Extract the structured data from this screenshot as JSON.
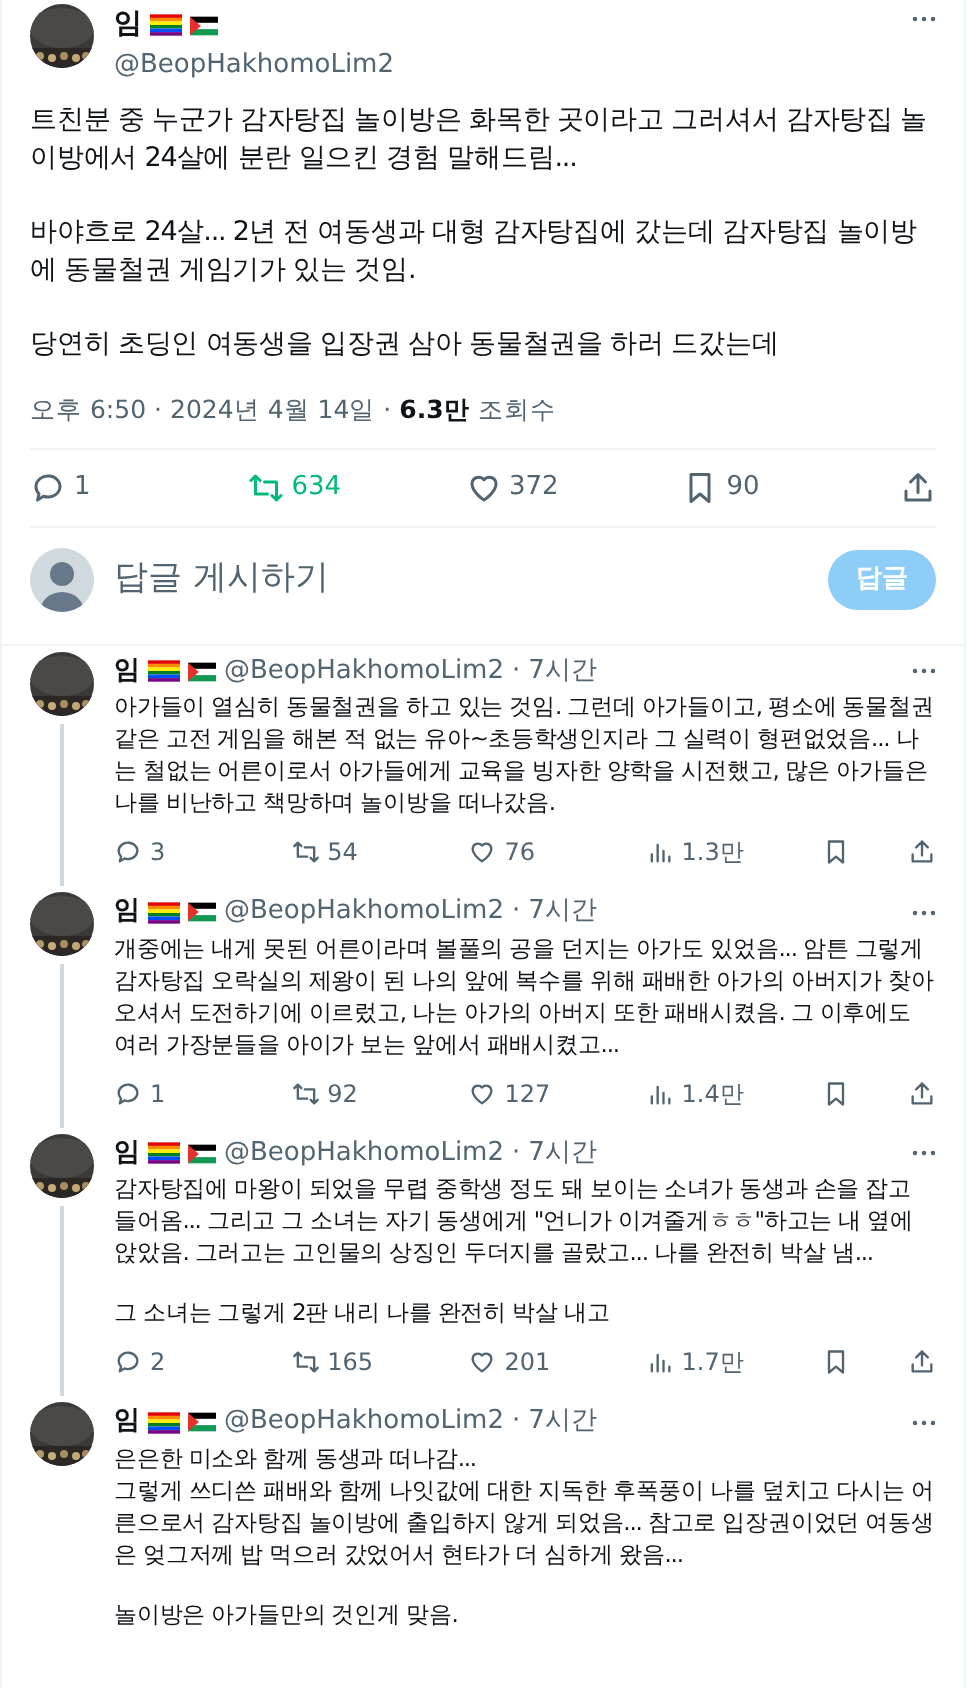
{
  "main_post": {
    "name": "임",
    "handle": "@BeopHakhomoLim2",
    "paragraphs": [
      "트친분 중 누군가 감자탕집 놀이방은 화목한 곳이라고 그러셔서 감자탕집 놀이방에서 24살에 분란 일으킨 경험 말해드림...",
      "바야흐로 24살... 2년 전 여동생과 대형 감자탕집에 갔는데 감자탕집 놀이방에 동물철권 게임기가 있는 것임.",
      "당연히 초딩인 여동생을 입장권 삼아 동물철권을 하러 드갔는데"
    ],
    "time": "오후 6:50",
    "separator": "·",
    "date": "2024년 4월 14일",
    "separator_2": "·",
    "views_count": "6.3만",
    "views_label": "조회수",
    "stats": [
      {
        "kind": "reply",
        "count": "1",
        "active": false
      },
      {
        "kind": "repost",
        "count": "634",
        "active": true
      },
      {
        "kind": "like",
        "count": "372",
        "active": false
      },
      {
        "kind": "bookmark",
        "count": "90",
        "active": false
      },
      {
        "kind": "share",
        "active": false
      }
    ]
  },
  "reply_box": {
    "placeholder": "답글 게시하기",
    "button": "답글",
    "disabled": true
  },
  "replies": [
    {
      "name": "임",
      "handle": "@BeopHakhomoLim2",
      "separator": "·",
      "time": "7시간",
      "paragraphs": [
        "아가들이 열심히 동물철권을 하고 있는 것임. 그런데 아가들이고, 평소에 동물철권 같은 고전 게임을 해본 적 없는 유아~초등학생인지라 그 실력이 형편없었음... 나는 철없는 어른이로서 아가들에게 교육을 빙자한 양학을 시전했고, 많은 아가들은 나를 비난하고 책망하며 놀이방을 떠나갔음."
      ],
      "stats": [
        {
          "kind": "reply",
          "count": "3",
          "active": false
        },
        {
          "kind": "repost",
          "count": "54",
          "active": false
        },
        {
          "kind": "like",
          "count": "76",
          "active": false
        },
        {
          "kind": "views",
          "count": "1.3만",
          "active": false
        },
        {
          "kind": "bookmark",
          "active": false
        },
        {
          "kind": "share",
          "active": false
        }
      ]
    },
    {
      "name": "임",
      "handle": "@BeopHakhomoLim2",
      "separator": "·",
      "time": "7시간",
      "paragraphs": [
        "개중에는 내게 못된 어른이라며 볼풀의 공을 던지는 아가도 있었음... 암튼 그렇게 감자탕집 오락실의 제왕이 된 나의 앞에 복수를 위해 패배한 아가의 아버지가 찾아오셔서 도전하기에 이르렀고, 나는 아가의 아버지 또한 패배시켰음. 그 이후에도 여러 가장분들을 아이가 보는 앞에서 패배시켰고..."
      ],
      "stats": [
        {
          "kind": "reply",
          "count": "1",
          "active": false
        },
        {
          "kind": "repost",
          "count": "92",
          "active": false
        },
        {
          "kind": "like",
          "count": "127",
          "active": false
        },
        {
          "kind": "views",
          "count": "1.4만",
          "active": false
        },
        {
          "kind": "bookmark",
          "active": false
        },
        {
          "kind": "share",
          "active": false
        }
      ]
    },
    {
      "name": "임",
      "handle": "@BeopHakhomoLim2",
      "separator": "·",
      "time": "7시간",
      "paragraphs": [
        "감자탕집에 마왕이 되었을 무렵 중학생 정도 돼 보이는 소녀가 동생과 손을 잡고 들어옴... 그리고 그 소녀는 자기 동생에게 \"언니가 이겨줄게ㅎㅎ\"하고는 내 옆에 앉았음. 그러고는 고인물의 상징인 두더지를 골랐고... 나를 완전히 박살 냄...",
        "그 소녀는 그렇게 2판 내리 나를 완전히 박살 내고"
      ],
      "stats": [
        {
          "kind": "reply",
          "count": "2",
          "active": false
        },
        {
          "kind": "repost",
          "count": "165",
          "active": false
        },
        {
          "kind": "like",
          "count": "201",
          "active": false
        },
        {
          "kind": "views",
          "count": "1.7만",
          "active": false
        },
        {
          "kind": "bookmark",
          "active": false
        },
        {
          "kind": "share",
          "active": false
        }
      ]
    },
    {
      "name": "임",
      "handle": "@BeopHakhomoLim2",
      "separator": "·",
      "time": "7시간",
      "paragraphs": [
        "은은한 미소와 함께 동생과 떠나감...\n그렇게 쓰디쓴 패배와 함께 나잇값에 대한 지독한 후폭풍이 나를 덮치고 다시는 어른으로서 감자탕집 놀이방에 출입하지 않게 되었음... 참고로 입장권이었던 여동생은 엊그저께 밥 먹으러 갔었어서 현타가 더 심하게 왔음...",
        "놀이방은 아가들만의 것인게 맞음."
      ]
    }
  ]
}
